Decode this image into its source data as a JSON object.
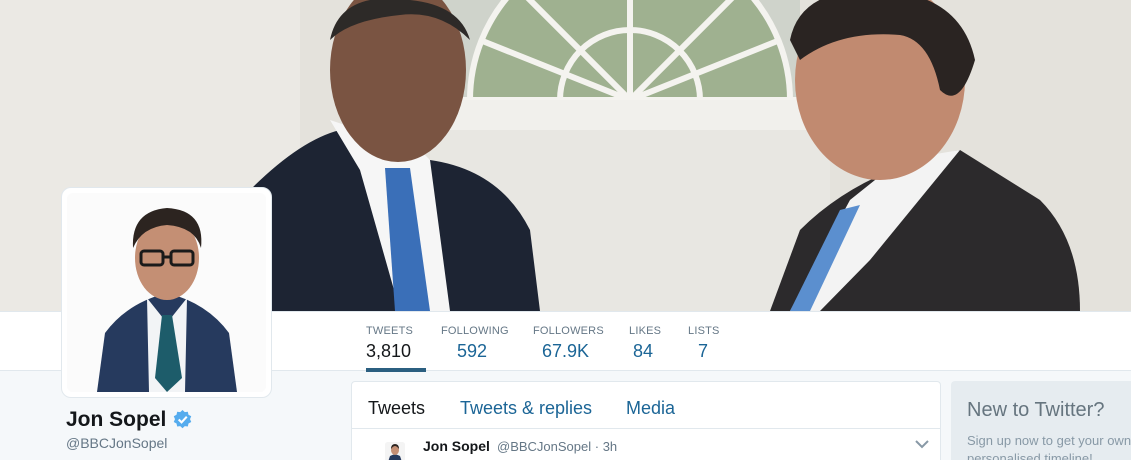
{
  "profile": {
    "name": "Jon Sopel",
    "handle": "@BBCJonSopel"
  },
  "stats": [
    {
      "label": "TWEETS",
      "value": "3,810"
    },
    {
      "label": "FOLLOWING",
      "value": "592"
    },
    {
      "label": "FOLLOWERS",
      "value": "67.9K"
    },
    {
      "label": "LIKES",
      "value": "84"
    },
    {
      "label": "LISTS",
      "value": "7"
    }
  ],
  "timeline": {
    "tabs": [
      "Tweets",
      "Tweets & replies",
      "Media"
    ],
    "tweet": {
      "name": "Jon Sopel",
      "handle_time": "@BBCJonSopel · 3h"
    }
  },
  "signup": {
    "title": "New to Twitter?",
    "text": "Sign up now to get your own personalised timeline!"
  },
  "icons": {
    "verified": "verified-badge-icon",
    "chevron": "chevron-down-icon"
  },
  "colors": {
    "link": "#1b6596",
    "active_underline": "#2b5f80",
    "verified": "#55acee"
  }
}
